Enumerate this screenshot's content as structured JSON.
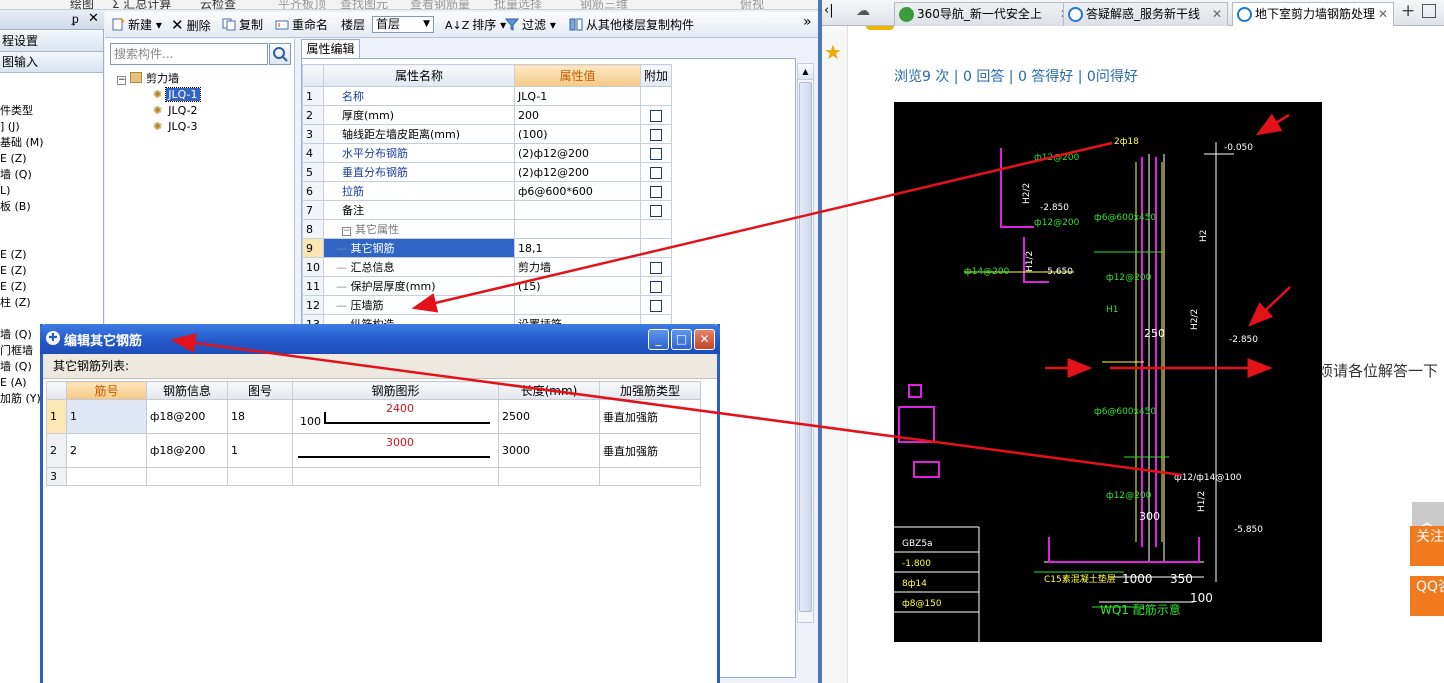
{
  "app": {
    "topstrip_items": [
      "绘图",
      "Σ 汇总计算",
      "云检查",
      "平齐板顶",
      "查找图元",
      "查看钢筋量",
      "批量选择",
      "钢筋三维",
      "俯视"
    ],
    "left_panel": {
      "pin_icon": "pin-icon",
      "tabs": [
        "程设置",
        "图输入"
      ],
      "items": [
        "件类型",
        "] (J)",
        "基础 (M)",
        "E (Z)",
        "墙 (Q)",
        "L)",
        "板 (B)",
        "E (Z)",
        "E (Z)",
        "E (Z)",
        "柱 (Z)",
        "墙 (Q)",
        "门框墙",
        "墙 (Q)",
        "E (A)",
        "加筋 (Y)"
      ]
    },
    "toolbar": {
      "new_label": "新建",
      "delete_label": "删除",
      "copy_label": "复制",
      "rename_label": "重命名",
      "floor_label": "楼层",
      "floor_value": "首层",
      "sort_label": "排序",
      "filter_label": "过滤",
      "copy_from_floor_label": "从其他楼层复制构件",
      "more": "»"
    },
    "tree": {
      "search_placeholder": "搜索构件...",
      "root": "剪力墙",
      "children": [
        "JLQ-1",
        "JLQ-2",
        "JLQ-3"
      ],
      "selected": "JLQ-1"
    },
    "properties": {
      "tab": "属性编辑",
      "headers": [
        "属性名称",
        "属性值",
        "附加"
      ],
      "rows": [
        {
          "n": "1",
          "name": "名称",
          "value": "JLQ-1",
          "blue": true,
          "check": false
        },
        {
          "n": "2",
          "name": "厚度(mm)",
          "value": "200",
          "blue": false,
          "check": true
        },
        {
          "n": "3",
          "name": "轴线距左墙皮距离(mm)",
          "value": "(100)",
          "blue": false,
          "check": true
        },
        {
          "n": "4",
          "name": "水平分布钢筋",
          "value": "(2)ф12@200",
          "blue": true,
          "check": true
        },
        {
          "n": "5",
          "name": "垂直分布钢筋",
          "value": "(2)ф12@200",
          "blue": true,
          "check": true
        },
        {
          "n": "6",
          "name": "拉筋",
          "value": "ф6@600*600",
          "blue": true,
          "check": true
        },
        {
          "n": "7",
          "name": "备注",
          "value": "",
          "blue": false,
          "check": true
        },
        {
          "n": "8",
          "name": "其它属性",
          "value": "",
          "blue": false,
          "check": false
        },
        {
          "n": "9",
          "name": "其它钢筋",
          "value": "18,1",
          "blue": false,
          "check": false
        },
        {
          "n": "10",
          "name": "汇总信息",
          "value": "剪力墙",
          "blue": false,
          "check": true
        },
        {
          "n": "11",
          "name": "保护层厚度(mm)",
          "value": "(15)",
          "blue": false,
          "check": true
        },
        {
          "n": "12",
          "name": "压墙筋",
          "value": "",
          "blue": false,
          "check": true
        },
        {
          "n": "13",
          "name": "纵筋构造",
          "value": "设置插筋",
          "blue": false,
          "check": false
        }
      ]
    }
  },
  "browser": {
    "tabs": [
      {
        "label": "360导航_新一代安全上",
        "active": false
      },
      {
        "label": "答疑解惑_服务新干线",
        "active": false
      },
      {
        "label": "地下室剪力墙钢筋处理",
        "active": true
      }
    ],
    "new_tab": "+",
    "stats": "浏览9 次 | 0 回答 | 0 答得好 | 0问得好",
    "question_text": "烦请各位解答一下",
    "float_buttons": [
      "关注我们",
      "QQ咨询"
    ],
    "cad": {
      "labels": [
        "-0.050",
        "2ф18",
        "ф12@200",
        "H2/2",
        "-2.850",
        "ф6@600x450",
        "H1/2",
        "-5.650",
        "ф14@200",
        "H2",
        "250",
        "-2.850",
        "H2/2",
        "ф6@600x450",
        "H1",
        "ф12/ф14@100",
        "H1/2",
        "300",
        "-5.850",
        "1000",
        "350",
        "100",
        "GBZ5a",
        "-1.800",
        "8ф14",
        "ф8@150",
        "WQ1 配筋示意",
        "C15素混凝土垫层"
      ]
    }
  },
  "dialog": {
    "title": "编辑其它钢筋",
    "list_label": "其它钢筋列表:",
    "headers": [
      "筋号",
      "钢筋信息",
      "图号",
      "钢筋图形",
      "长度(mm)",
      "加强筋类型"
    ],
    "rows": [
      {
        "n": "1",
        "no": "1",
        "info": "ф18@200",
        "fig": "18",
        "shape_label": "2400",
        "shape_left": "100",
        "length": "2500",
        "type": "垂直加强筋"
      },
      {
        "n": "2",
        "no": "2",
        "info": "ф18@200",
        "fig": "1",
        "shape_label": "3000",
        "shape_left": "",
        "length": "3000",
        "type": "垂直加强筋"
      },
      {
        "n": "3",
        "no": "",
        "info": "",
        "fig": "",
        "shape_label": "",
        "shape_left": "",
        "length": "",
        "type": ""
      }
    ]
  },
  "colors": {
    "arrow": "#e3121a",
    "cad_bg": "#000000",
    "dialog_title": "#2459c9",
    "accent_orange": "#f27a1e"
  }
}
